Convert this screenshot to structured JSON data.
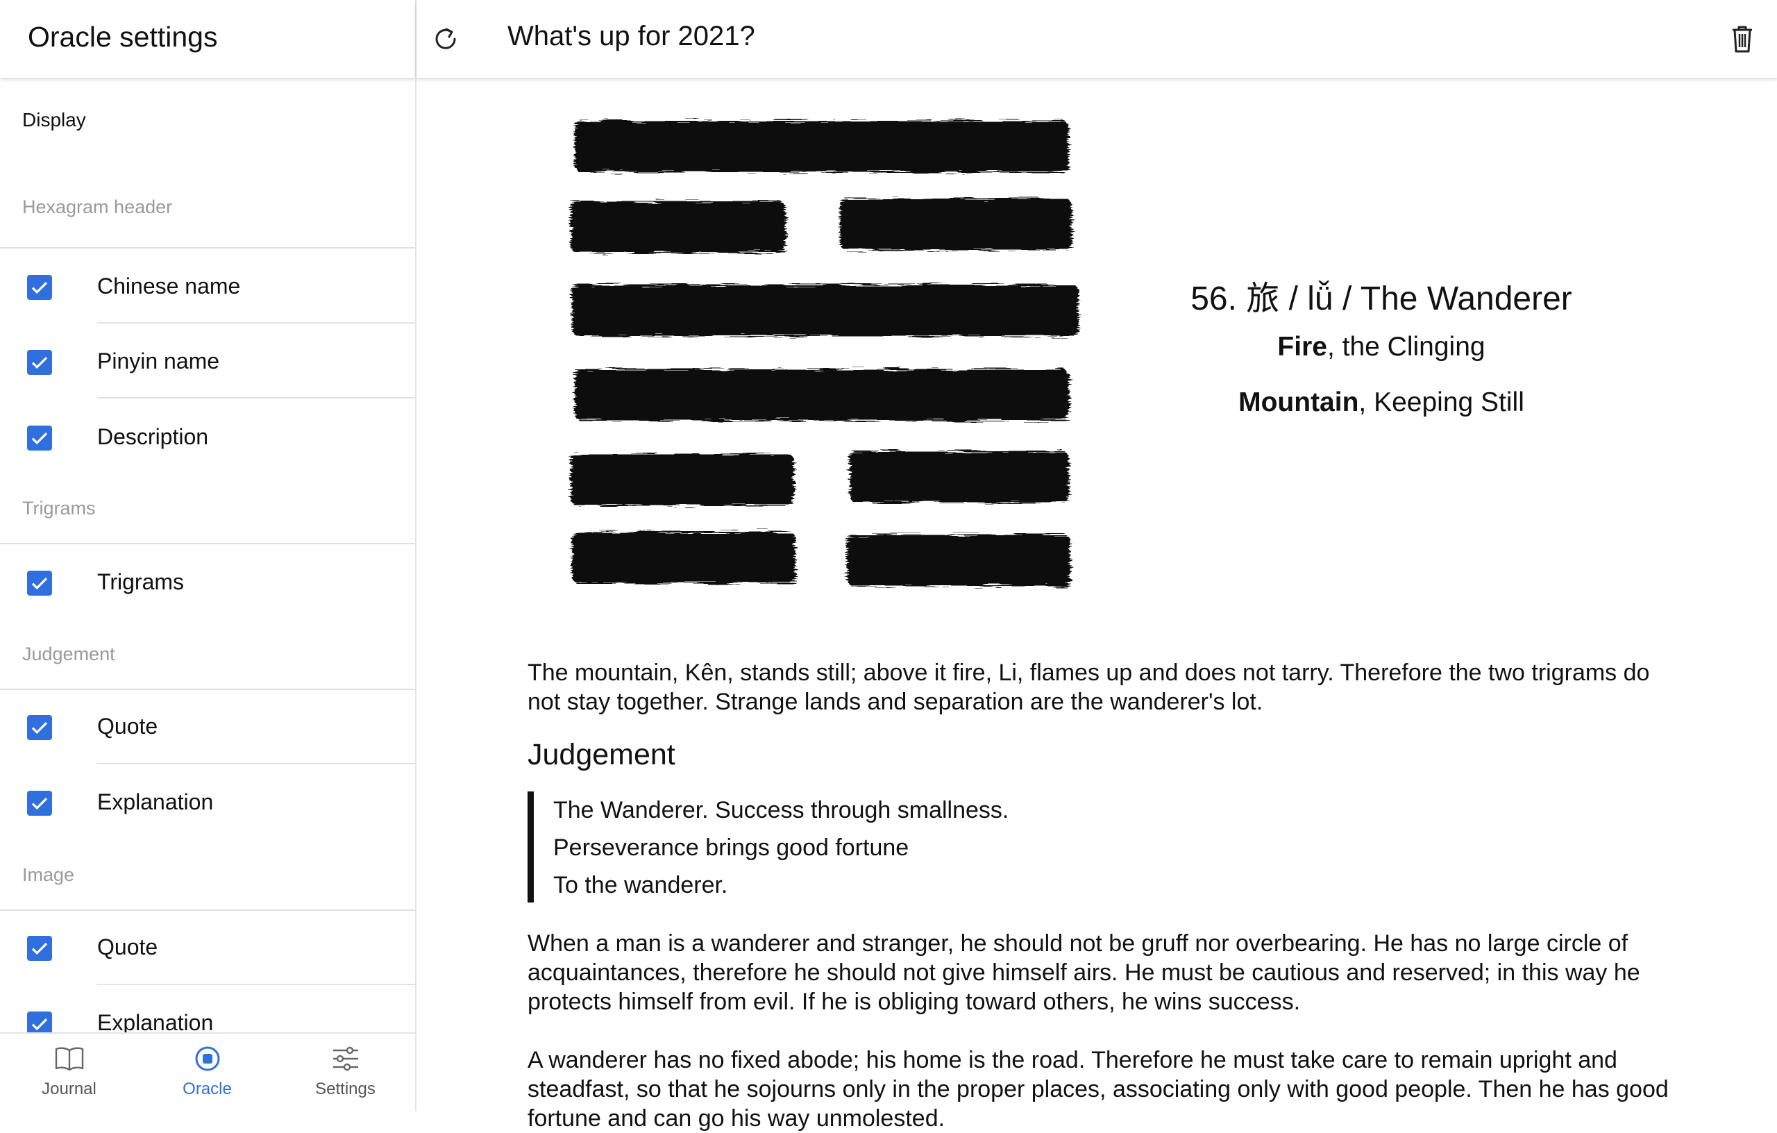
{
  "sidebar": {
    "title": "Oracle settings",
    "display_label": "Display",
    "sections": {
      "hexagram_header": {
        "heading": "Hexagram header",
        "items": [
          {
            "label": "Chinese name",
            "checked": true
          },
          {
            "label": "Pinyin name",
            "checked": true
          },
          {
            "label": "Description",
            "checked": true
          }
        ]
      },
      "trigrams": {
        "heading": "Trigrams",
        "items": [
          {
            "label": "Trigrams",
            "checked": true
          }
        ]
      },
      "judgement": {
        "heading": "Judgement",
        "items": [
          {
            "label": "Quote",
            "checked": true
          },
          {
            "label": "Explanation",
            "checked": true
          }
        ]
      },
      "image": {
        "heading": "Image",
        "items": [
          {
            "label": "Quote",
            "checked": true
          },
          {
            "label": "Explanation",
            "checked": true
          }
        ]
      }
    }
  },
  "bottom_nav": {
    "items": [
      {
        "label": "Journal",
        "icon": "book-icon",
        "active": false
      },
      {
        "label": "Oracle",
        "icon": "oracle-icon",
        "active": true
      },
      {
        "label": "Settings",
        "icon": "sliders-icon",
        "active": false
      }
    ]
  },
  "colors": {
    "accent": "#2f6fde",
    "muted_heading": "#9a9a9a",
    "divider": "#e3e3e3",
    "ink": "#111111"
  },
  "main": {
    "title": "What's up for 2021?",
    "hexagram": {
      "lines_top_to_bottom": [
        "solid",
        "broken",
        "solid",
        "solid",
        "broken",
        "broken"
      ],
      "name": "56. 旅 / lǚ / The Wanderer",
      "upper_trigram": {
        "name": "Fire",
        "desc": ", the Clinging"
      },
      "lower_trigram": {
        "name": "Mountain",
        "desc": ", Keeping Still"
      }
    },
    "intro": "The mountain, Kên, stands still; above it fire, Li, flames up and does not tarry. Therefore the two trigrams do not stay together. Strange lands and separation are the wanderer's lot.",
    "judgement": {
      "heading": "Judgement",
      "quote_lines": [
        "The Wanderer. Success through smallness.",
        "Perseverance brings good fortune",
        "To the wanderer."
      ],
      "explanation_1": "When a man is a wanderer and stranger, he should not be gruff nor overbearing. He has no large circle of acquaintances, therefore he should not give himself airs. He must be cautious and reserved; in this way he protects himself from evil. If he is obliging toward others, he wins success.",
      "explanation_2": "A wanderer has no fixed abode; his home is the road. Therefore he must take care to remain upright and steadfast, so that he sojourns only in the proper places, associating only with good people. Then he has good fortune and can go his way unmolested."
    }
  }
}
